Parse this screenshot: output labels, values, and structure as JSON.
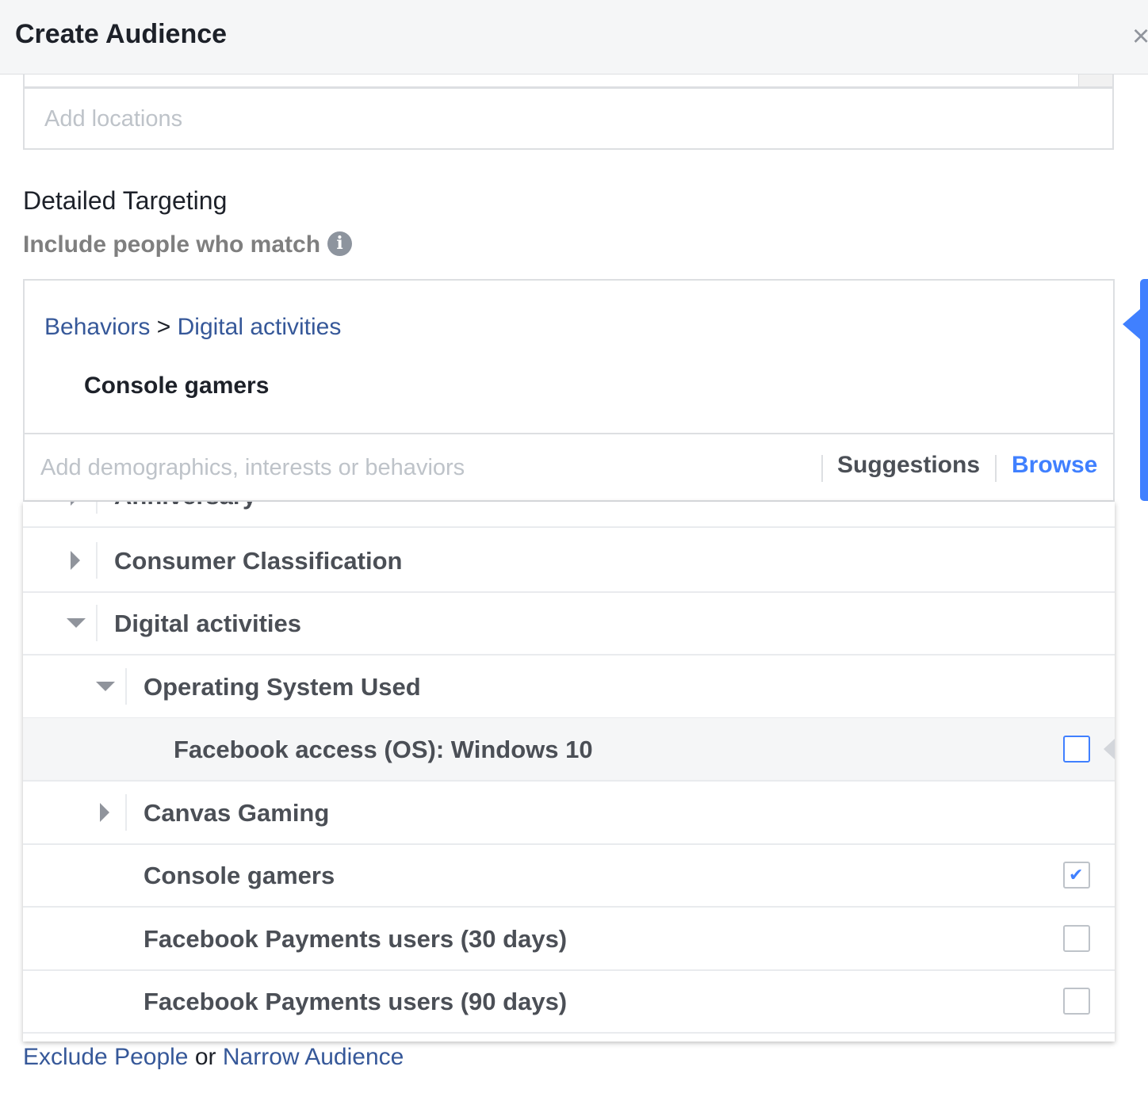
{
  "header": {
    "title": "Create Audience",
    "close_glyph": "×"
  },
  "locations": {
    "placeholder": "Add locations"
  },
  "detailed_targeting": {
    "title": "Detailed Targeting",
    "subtitle": "Include people who match",
    "info_glyph": "i",
    "breadcrumb": {
      "parent": "Behaviors",
      "separator": ">",
      "child": "Digital activities"
    },
    "selected_item": "Console gamers",
    "search_placeholder": "Add demographics, interests or behaviors",
    "suggestions_label": "Suggestions",
    "browse_label": "Browse"
  },
  "browse_list": {
    "rows": [
      {
        "label": "Anniversary",
        "expandable": true,
        "expanded": false
      },
      {
        "label": "Consumer Classification",
        "expandable": true,
        "expanded": false
      },
      {
        "label": "Digital activities",
        "expandable": true,
        "expanded": true
      },
      {
        "label": "Operating System Used",
        "expandable": true,
        "expanded": true
      },
      {
        "label": "Facebook access (OS): Windows 10",
        "checked": false,
        "highlighted": true
      },
      {
        "label": "Canvas Gaming",
        "expandable": true,
        "expanded": false
      },
      {
        "label": "Console gamers",
        "checked": true
      },
      {
        "label": "Facebook Payments users (30 days)",
        "checked": false
      },
      {
        "label": "Facebook Payments users (90 days)",
        "checked": false
      }
    ]
  },
  "footer": {
    "exclude_label": "Exclude People",
    "or_label": "or",
    "narrow_label": "Narrow Audience"
  },
  "colors": {
    "link": "#365899",
    "accent": "#4080ff",
    "muted_text": "#4b4f56"
  },
  "icons": {
    "info": "info-icon",
    "close": "close-icon",
    "check": "checkmark-icon"
  }
}
